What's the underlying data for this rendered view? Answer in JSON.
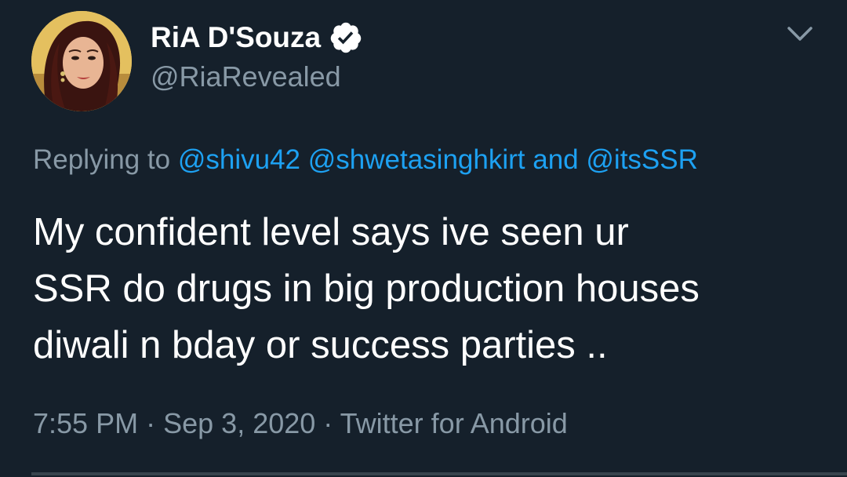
{
  "author": {
    "display_name": "RiA D'Souza",
    "handle": "@RiaRevealed",
    "verified_icon": "verified-badge-icon",
    "avatar": "profile-photo"
  },
  "menu_icon": "chevron-down-icon",
  "reply": {
    "prefix": "Replying to",
    "mention_1": "@shivu42",
    "mention_2": "@shwetasinghkirt",
    "conjunction": "and",
    "mention_3": "@itsSSR"
  },
  "tweet_text": "My confident level says ive seen ur\nSSR do drugs in big production houses\ndiwali  n bday or success parties ..",
  "meta": {
    "time": "7:55 PM",
    "separator": "·",
    "date": "Sep 3, 2020",
    "source": "Twitter for Android"
  },
  "colors": {
    "background": "#15202b",
    "text_primary": "#ffffff",
    "text_secondary": "#8899a6",
    "link": "#1da1f2",
    "divider": "#38444d"
  }
}
